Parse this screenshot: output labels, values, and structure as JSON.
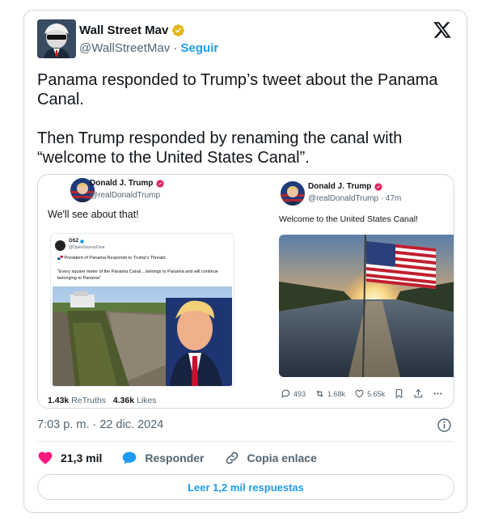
{
  "author": {
    "name": "Wall Street Mav",
    "handle": "@WallStreetMav",
    "separator": " · ",
    "follow_label": "Seguir"
  },
  "tweet": {
    "text": "Panama responded to Trump’s tweet about the Panama Canal.\n\nThen Trump responded by renaming the canal with “welcome to the United States Canal”."
  },
  "media": {
    "left": {
      "name": "Donald J. Trump",
      "handle": "@realDonaldTrump",
      "text": "We'll see about that!",
      "quote": {
        "name": "OSZ",
        "handle": "@OpenSourceZone",
        "headline": "President of Panama Responds to Trump's Threats:",
        "quote_text": "\"Every square meter of the Panama Canal... belongs to Panama and will continue belonging to Panama\""
      },
      "retruths_count": "1.43k",
      "retruths_label": "ReTruths",
      "likes_count": "4.36k",
      "likes_label": "Likes"
    },
    "right": {
      "name": "Donald J. Trump",
      "handle": "@realDonaldTrump · 47m",
      "text": "Welcome to the United States Canal!",
      "replies": "493",
      "reposts": "1.68k",
      "likes": "5.65k"
    }
  },
  "timestamp": "7:03 p. m. · 22 dic. 2024",
  "actions": {
    "like_count": "21,3 mil",
    "reply_label": "Responder",
    "copy_label": "Copia enlace"
  },
  "read_more_label": "Leer 1,2 mil respuestas",
  "colors": {
    "accent": "#1d9bf0",
    "like": "#f91880",
    "verified_gold": "#e2b719",
    "text": "#0f1419",
    "muted": "#536471"
  },
  "icons": [
    "verified-badge-icon",
    "x-logo-icon",
    "info-icon",
    "heart-icon",
    "reply-icon",
    "link-icon",
    "retweet-icon",
    "bookmark-icon",
    "share-icon",
    "more-icon"
  ]
}
